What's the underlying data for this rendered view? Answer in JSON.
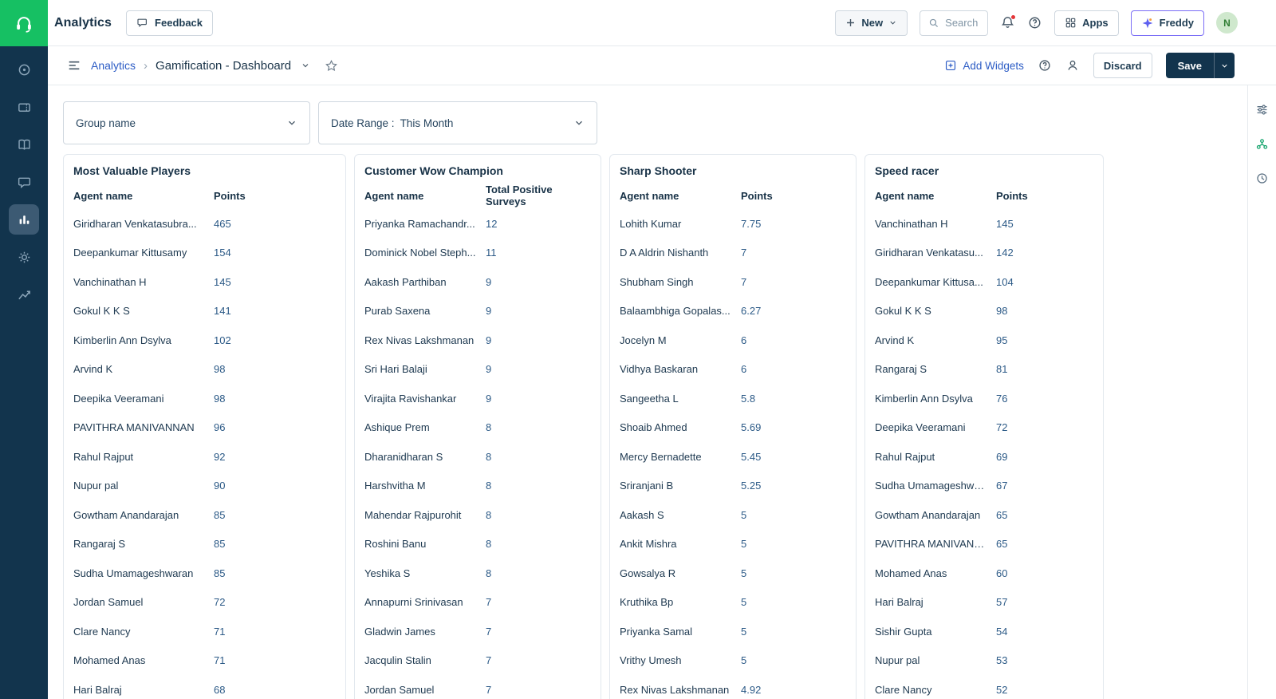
{
  "colors": {
    "sidebar_navy": "#12344d",
    "brand_green": "#16c063",
    "link_blue": "#2c5cc5",
    "save_navy": "#12344d",
    "notification_red": "#e43538",
    "freddy_border": "#7b6ef6"
  },
  "topbar": {
    "app_title": "Analytics",
    "feedback_label": "Feedback",
    "new_label": "New",
    "search_placeholder": "Search",
    "apps_label": "Apps",
    "freddy_label": "Freddy",
    "avatar_initial": "N"
  },
  "breadcrumb": {
    "root": "Analytics",
    "separator": "›",
    "current": "Gamification - Dashboard"
  },
  "actions": {
    "add_widgets": "Add Widgets",
    "discard": "Discard",
    "save": "Save"
  },
  "filters": {
    "group_label": "Group name",
    "date_range_label": "Date Range :",
    "date_range_value": "This Month"
  },
  "widgets": [
    {
      "title": "Most Valuable Players",
      "columns": [
        "Agent name",
        "Points"
      ],
      "rows": [
        [
          "Giridharan Venkatasubra...",
          "465"
        ],
        [
          "Deepankumar Kittusamy",
          "154"
        ],
        [
          "Vanchinathan H",
          "145"
        ],
        [
          "Gokul K K S",
          "141"
        ],
        [
          "Kimberlin Ann Dsylva",
          "102"
        ],
        [
          "Arvind K",
          "98"
        ],
        [
          "Deepika Veeramani",
          "98"
        ],
        [
          "PAVITHRA MANIVANNAN",
          "96"
        ],
        [
          "Rahul Rajput",
          "92"
        ],
        [
          "Nupur pal",
          "90"
        ],
        [
          "Gowtham Anandarajan",
          "85"
        ],
        [
          "Rangaraj S",
          "85"
        ],
        [
          "Sudha Umamageshwaran",
          "85"
        ],
        [
          "Jordan Samuel",
          "72"
        ],
        [
          "Clare Nancy",
          "71"
        ],
        [
          "Mohamed Anas",
          "71"
        ],
        [
          "Hari Balraj",
          "68"
        ]
      ]
    },
    {
      "title": "Customer Wow Champion",
      "columns": [
        "Agent name",
        "Total Positive Surveys"
      ],
      "rows": [
        [
          "Priyanka Ramachandr...",
          "12"
        ],
        [
          "Dominick Nobel Steph...",
          "11"
        ],
        [
          "Aakash Parthiban",
          "9"
        ],
        [
          "Purab Saxena",
          "9"
        ],
        [
          "Rex Nivas Lakshmanan",
          "9"
        ],
        [
          "Sri Hari Balaji",
          "9"
        ],
        [
          "Virajita Ravishankar",
          "9"
        ],
        [
          "Ashique Prem",
          "8"
        ],
        [
          "Dharanidharan S",
          "8"
        ],
        [
          "Harshvitha M",
          "8"
        ],
        [
          "Mahendar Rajpurohit",
          "8"
        ],
        [
          "Roshini Banu",
          "8"
        ],
        [
          "Yeshika S",
          "8"
        ],
        [
          "Annapurni Srinivasan",
          "7"
        ],
        [
          "Gladwin James",
          "7"
        ],
        [
          "Jacqulin Stalin",
          "7"
        ],
        [
          "Jordan Samuel",
          "7"
        ]
      ]
    },
    {
      "title": "Sharp Shooter",
      "columns": [
        "Agent name",
        "Points"
      ],
      "rows": [
        [
          "Lohith Kumar",
          "7.75"
        ],
        [
          "D A Aldrin Nishanth",
          "7"
        ],
        [
          "Shubham Singh",
          "7"
        ],
        [
          "Balaambhiga Gopalas...",
          "6.27"
        ],
        [
          "Jocelyn M",
          "6"
        ],
        [
          "Vidhya Baskaran",
          "6"
        ],
        [
          "Sangeetha L",
          "5.8"
        ],
        [
          "Shoaib Ahmed",
          "5.69"
        ],
        [
          "Mercy Bernadette",
          "5.45"
        ],
        [
          "Sriranjani B",
          "5.25"
        ],
        [
          "Aakash S",
          "5"
        ],
        [
          "Ankit Mishra",
          "5"
        ],
        [
          "Gowsalya R",
          "5"
        ],
        [
          "Kruthika Bp",
          "5"
        ],
        [
          "Priyanka Samal",
          "5"
        ],
        [
          "Vrithy Umesh",
          "5"
        ],
        [
          "Rex Nivas Lakshmanan",
          "4.92"
        ]
      ]
    },
    {
      "title": "Speed racer",
      "columns": [
        "Agent name",
        "Points"
      ],
      "rows": [
        [
          "Vanchinathan H",
          "145"
        ],
        [
          "Giridharan Venkatasu...",
          "142"
        ],
        [
          "Deepankumar Kittusa...",
          "104"
        ],
        [
          "Gokul K K S",
          "98"
        ],
        [
          "Arvind K",
          "95"
        ],
        [
          "Rangaraj S",
          "81"
        ],
        [
          "Kimberlin Ann Dsylva",
          "76"
        ],
        [
          "Deepika Veeramani",
          "72"
        ],
        [
          "Rahul Rajput",
          "69"
        ],
        [
          "Sudha Umamageshwa...",
          "67"
        ],
        [
          "Gowtham Anandarajan",
          "65"
        ],
        [
          "PAVITHRA MANIVANN...",
          "65"
        ],
        [
          "Mohamed Anas",
          "60"
        ],
        [
          "Hari Balraj",
          "57"
        ],
        [
          "Sishir Gupta",
          "54"
        ],
        [
          "Nupur pal",
          "53"
        ],
        [
          "Clare Nancy",
          "52"
        ]
      ]
    }
  ]
}
